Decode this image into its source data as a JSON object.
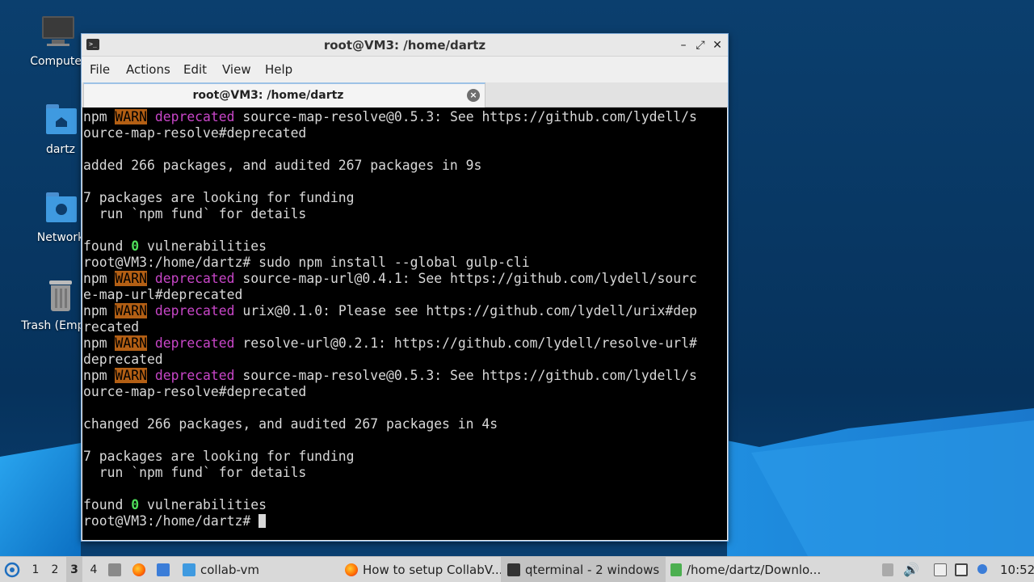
{
  "desktop": {
    "icons": [
      {
        "label": "Computer",
        "icon": "computer-icon"
      },
      {
        "label": "dartz",
        "icon": "home-folder-icon"
      },
      {
        "label": "Network",
        "icon": "network-folder-icon"
      },
      {
        "label": "Trash (Empty)",
        "icon": "trash-icon"
      }
    ]
  },
  "window": {
    "title": "root@VM3: /home/dartz",
    "menu": [
      "File",
      "Actions",
      "Edit",
      "View",
      "Help"
    ],
    "tab_label": "root@VM3: /home/dartz",
    "controls": {
      "minimize": "–",
      "maximize": "⤢",
      "close": "✕"
    }
  },
  "terminal": {
    "lines": [
      [
        "npm ",
        {
          "warn": "WARN"
        },
        " ",
        {
          "dep": "deprecated"
        },
        " source-map-resolve@0.5.3: See https://github.com/lydell/s"
      ],
      [
        "ource-map-resolve#deprecated"
      ],
      [
        ""
      ],
      [
        "added 266 packages, and audited 267 packages in 9s"
      ],
      [
        ""
      ],
      [
        "7 packages are looking for funding"
      ],
      [
        "  run `npm fund` for details"
      ],
      [
        ""
      ],
      [
        "found ",
        {
          "zero": "0"
        },
        " vulnerabilities"
      ],
      [
        "root@VM3:/home/dartz# sudo npm install --global gulp-cli"
      ],
      [
        "npm ",
        {
          "warn": "WARN"
        },
        " ",
        {
          "dep": "deprecated"
        },
        " source-map-url@0.4.1: See https://github.com/lydell/sourc"
      ],
      [
        "e-map-url#deprecated"
      ],
      [
        "npm ",
        {
          "warn": "WARN"
        },
        " ",
        {
          "dep": "deprecated"
        },
        " urix@0.1.0: Please see https://github.com/lydell/urix#dep"
      ],
      [
        "recated"
      ],
      [
        "npm ",
        {
          "warn": "WARN"
        },
        " ",
        {
          "dep": "deprecated"
        },
        " resolve-url@0.2.1: https://github.com/lydell/resolve-url#"
      ],
      [
        "deprecated"
      ],
      [
        "npm ",
        {
          "warn": "WARN"
        },
        " ",
        {
          "dep": "deprecated"
        },
        " source-map-resolve@0.5.3: See https://github.com/lydell/s"
      ],
      [
        "ource-map-resolve#deprecated"
      ],
      [
        ""
      ],
      [
        "changed 266 packages, and audited 267 packages in 4s"
      ],
      [
        ""
      ],
      [
        "7 packages are looking for funding"
      ],
      [
        "  run `npm fund` for details"
      ],
      [
        ""
      ],
      [
        "found ",
        {
          "zero": "0"
        },
        " vulnerabilities"
      ],
      [
        "root@VM3:/home/dartz# ",
        {
          "cursor": true
        }
      ]
    ]
  },
  "taskbar": {
    "workspaces": [
      "1",
      "2",
      "3",
      "4"
    ],
    "active_workspace": "3",
    "tasks": [
      {
        "label": "collab-vm",
        "icon": "folder-icon"
      },
      {
        "label": "How to setup CollabV...",
        "icon": "firefox-icon"
      },
      {
        "label": "qterminal - 2 windows",
        "icon": "terminal-icon"
      },
      {
        "label": "/home/dartz/Downlo...",
        "icon": "archive-icon"
      }
    ],
    "clock": "10:52"
  },
  "colors": {
    "warn_bg": "#b35f14",
    "deprecated": "#c846c8",
    "zero": "#4fe05a",
    "terminal_bg": "#000000"
  }
}
